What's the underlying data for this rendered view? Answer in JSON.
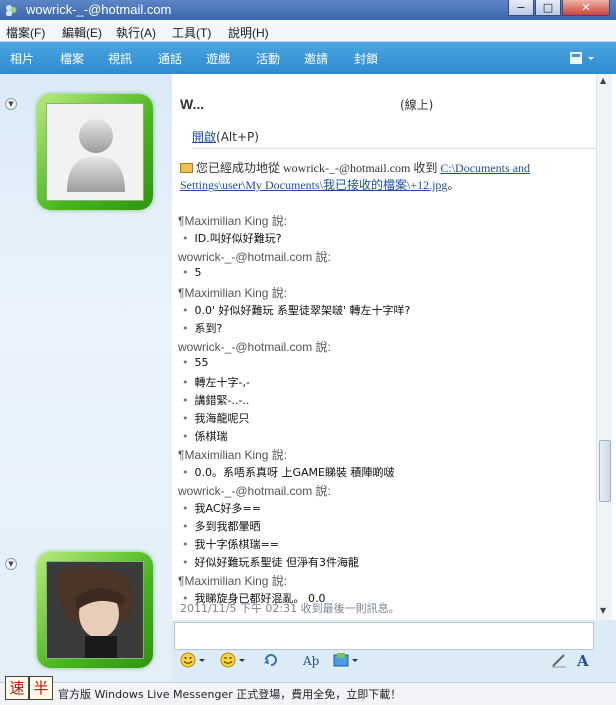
{
  "window": {
    "title": "wowrick-_-@hotmail.com",
    "buttons": [
      "−",
      "□",
      "✕"
    ]
  },
  "menu": [
    {
      "label": "檔案(F)"
    },
    {
      "label": "編輯(E)"
    },
    {
      "label": "執行(A)"
    },
    {
      "label": "工具(T)"
    },
    {
      "label": "說明(H)"
    }
  ],
  "toolbar": [
    {
      "label": "相片"
    },
    {
      "label": "檔案"
    },
    {
      "label": "視訊"
    },
    {
      "label": "通話"
    },
    {
      "label": "遊戲"
    },
    {
      "label": "活動"
    },
    {
      "label": "邀請"
    },
    {
      "label": "封鎖"
    }
  ],
  "contact": {
    "name": "W...",
    "status": "(線上)"
  },
  "transfer": {
    "open_label": "開啟",
    "open_shortcut": "(Alt+P)",
    "message": "您已經成功地從 wowrick-_-@hotmail.com 收到",
    "path": "C:\\Documents and Settings\\user\\My Documents\\我已接收的檔案\\+12.jpg",
    "suffix": "。"
  },
  "messages": [
    {
      "type": "sender",
      "text": "¶Maximilian King 說:"
    },
    {
      "type": "line",
      "text": "ID.叫好似好難玩?"
    },
    {
      "type": "sender",
      "text": "wowrick-_-@hotmail.com 說:"
    },
    {
      "type": "line",
      "text": "5"
    },
    {
      "type": "sender",
      "text": "¶Maximilian King 說:"
    },
    {
      "type": "line",
      "text": "0.0' 好似好難玩 系聖徒翠架啵' 轉左十字咩?"
    },
    {
      "type": "line",
      "text": "系到?"
    },
    {
      "type": "sender",
      "text": "wowrick-_-@hotmail.com 說:"
    },
    {
      "type": "line",
      "text": "55"
    },
    {
      "type": "line",
      "text": "轉左十字-,-"
    },
    {
      "type": "line",
      "text": "講錯緊-..-.."
    },
    {
      "type": "line",
      "text": "我海龍呢只"
    },
    {
      "type": "line",
      "text": "係棋瑞"
    },
    {
      "type": "sender",
      "text": "¶Maximilian King 說:"
    },
    {
      "type": "line",
      "text": "0.0。系唔系真呀 上GAME睇裝 積陣啲啵"
    },
    {
      "type": "sender",
      "text": "wowrick-_-@hotmail.com 說:"
    },
    {
      "type": "line",
      "text": "我AC好多=="
    },
    {
      "type": "line",
      "text": "多到我都暈晒"
    },
    {
      "type": "line",
      "text": "我十字係棋瑞=="
    },
    {
      "type": "line",
      "text": "好似好難玩系聖徒 但淨有3件海龍"
    },
    {
      "type": "sender",
      "text": "¶Maximilian King 說:"
    },
    {
      "type": "line",
      "text": "我睇旋身已都好混亂。 0.0"
    }
  ],
  "last_received": "2011/11/5 下午 02:31 收到最後一則訊息。",
  "ime": [
    "速",
    "半"
  ],
  "ad_text": "官方版 Windows Live Messenger 正式登場，費用全免，立即下載！",
  "icons": {
    "title": "messenger-icon",
    "toolbar_menu": "layout-menu-icon",
    "emoticon": "emoticon-icon",
    "wink": "wink-icon",
    "nudge": "nudge-icon",
    "font": "font-icon",
    "background": "background-icon",
    "handwriting": "handwriting-icon",
    "text_format": "text-format-icon"
  },
  "colors": {
    "toolbar": "#3a97d8",
    "avatar_frame": "#46b51c",
    "link": "#1d4ea6"
  }
}
